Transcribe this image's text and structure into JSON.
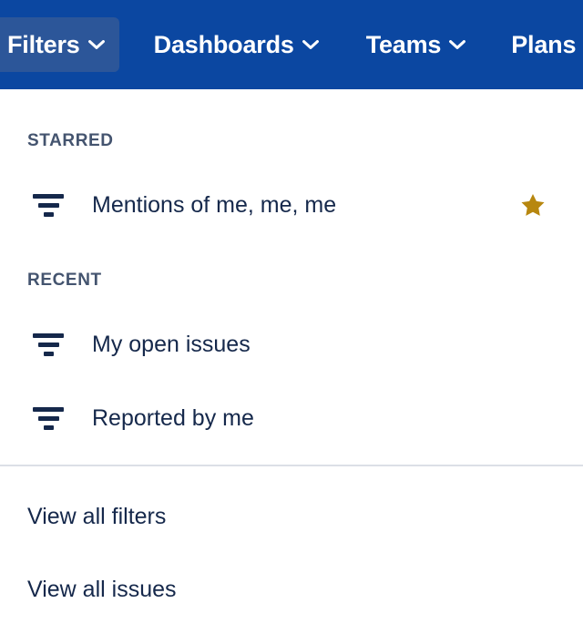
{
  "navbar": {
    "background_color": "#0B47A1",
    "active_background_color": "#2C5699",
    "items": [
      {
        "label": "Filters",
        "icon": "chevron-down-icon",
        "active": true
      },
      {
        "label": "Dashboards",
        "icon": "chevron-down-icon",
        "active": false
      },
      {
        "label": "Teams",
        "icon": "chevron-down-icon",
        "active": false
      },
      {
        "label": "Plans",
        "icon": "chevron-down-icon",
        "active": false
      }
    ]
  },
  "dropdown": {
    "sections": [
      {
        "header": "STARRED",
        "items": [
          {
            "label": "Mentions of me, me, me",
            "icon": "filter-icon",
            "starred": true,
            "star_icon": "star-filled-icon",
            "star_color": "#B7870F"
          }
        ]
      },
      {
        "header": "RECENT",
        "items": [
          {
            "label": "My open issues",
            "icon": "filter-icon",
            "starred": false
          },
          {
            "label": "Reported by me",
            "icon": "filter-icon",
            "starred": false
          }
        ]
      }
    ],
    "footer_links": [
      {
        "label": "View all filters"
      },
      {
        "label": "View all issues"
      }
    ],
    "divider_color": "#DCDFE6",
    "text_color": "#15284B",
    "section_header_color": "#44546F"
  }
}
